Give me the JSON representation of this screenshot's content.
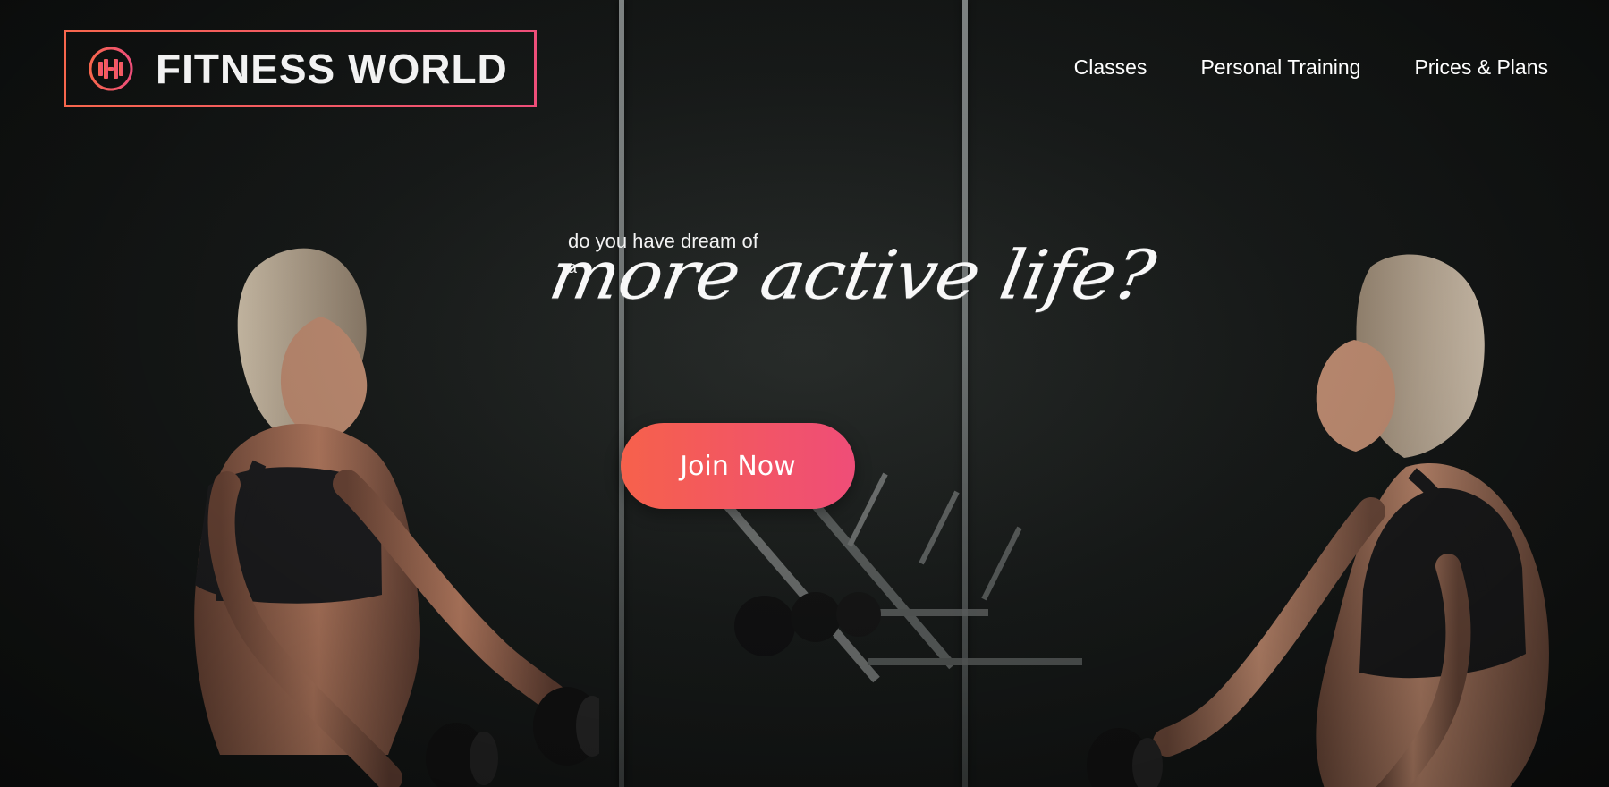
{
  "header": {
    "brand_name": "FITNESS WORLD",
    "nav": {
      "items": [
        {
          "label": "Classes"
        },
        {
          "label": "Personal Training"
        },
        {
          "label": "Prices & Plans"
        }
      ]
    }
  },
  "hero": {
    "kicker_line_1": "do you have dream of",
    "kicker_line_2": "a",
    "headline": "more active life?",
    "cta_label": "Join Now"
  },
  "icons": {
    "brand_logo_icon": "dumbbell-icon"
  },
  "colors": {
    "accent_start": "#f6614b",
    "accent_end": "#ef4d78",
    "text_primary": "#ffffff",
    "background_dark": "#141717"
  }
}
